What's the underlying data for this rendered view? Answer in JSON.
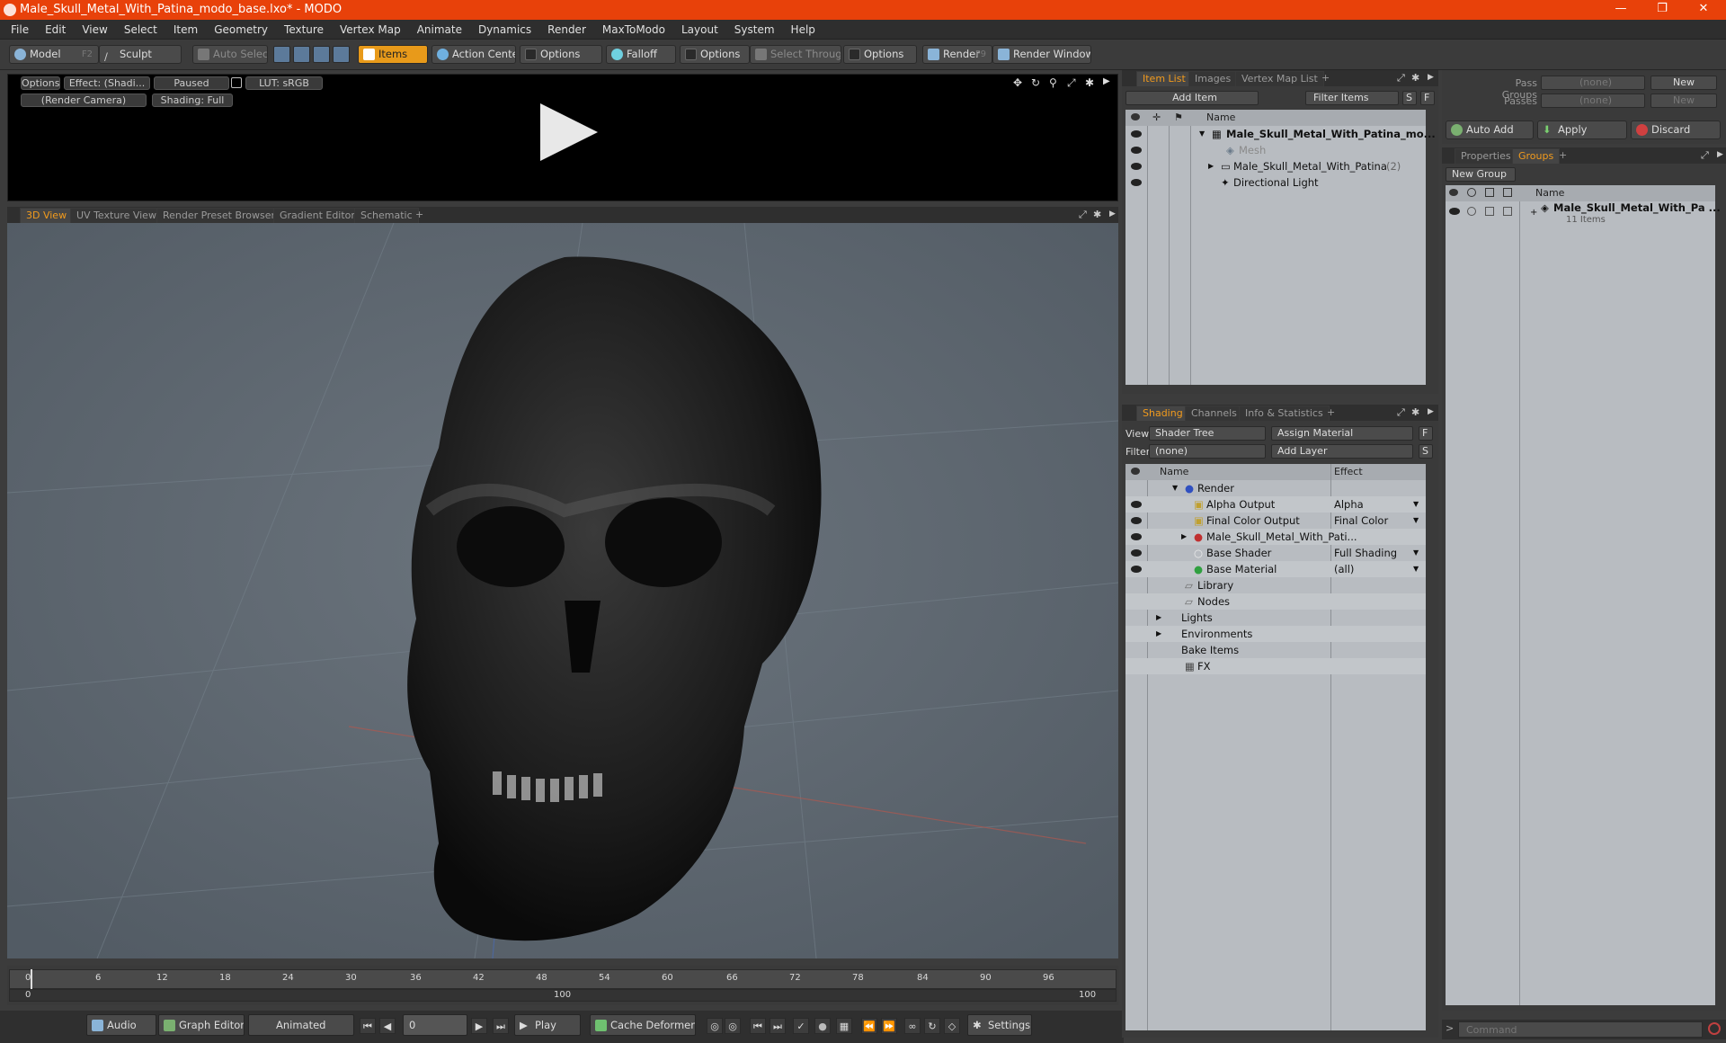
{
  "title": "Male_Skull_Metal_With_Patina_modo_base.lxo* - MODO",
  "window_controls": {
    "minimize": "—",
    "restore": "❐",
    "close": "✕"
  },
  "menu": [
    "File",
    "Edit",
    "View",
    "Select",
    "Item",
    "Geometry",
    "Texture",
    "Vertex Map",
    "Animate",
    "Dynamics",
    "Render",
    "MaxToModo",
    "Layout",
    "System",
    "Help"
  ],
  "toolbar": {
    "model": "Model",
    "model_key": "F2",
    "sculpt": "Sculpt",
    "auto_select": "Auto Select",
    "items": "Items",
    "action_center": "Action Center",
    "options1": "Options",
    "falloff": "Falloff",
    "options2": "Options",
    "select_through": "Select Through",
    "options3": "Options",
    "render": "Render",
    "render_key": "F9",
    "render_window": "Render Window"
  },
  "preview": {
    "options": "Options",
    "effect": "Effect: (Shadi...",
    "paused": "Paused",
    "lut": "LUT: sRGB",
    "camera": "(Render Camera)",
    "shading": "Shading: Full"
  },
  "viewport_tabs": [
    "3D View",
    "UV Texture View",
    "Render Preset Browser",
    "Gradient Editor",
    "Schematic",
    "+"
  ],
  "timeline": {
    "ticks": [
      "0",
      "6",
      "12",
      "18",
      "24",
      "30",
      "36",
      "42",
      "48",
      "54",
      "60",
      "66",
      "72",
      "78",
      "84",
      "90",
      "96"
    ],
    "range_start": "0",
    "range_mid": "100",
    "range_end": "100"
  },
  "bottom": {
    "audio": "Audio",
    "graph_editor": "Graph Editor",
    "animated": "Animated",
    "frame": "0",
    "play": "Play",
    "cache_deformers": "Cache Deformers",
    "settings": "Settings"
  },
  "item_list": {
    "tabs": [
      "Item List",
      "Images",
      "Vertex Map List",
      "+"
    ],
    "add_item": "Add Item",
    "filter_items": "Filter Items",
    "s": "S",
    "f": "F",
    "col_name": "Name",
    "rows": [
      {
        "label": "Male_Skull_Metal_With_Patina_mo..."
      },
      {
        "label": "Mesh"
      },
      {
        "label": "Male_Skull_Metal_With_Patina",
        "count": "(2)"
      },
      {
        "label": "Directional Light"
      }
    ]
  },
  "shading": {
    "tabs": [
      "Shading",
      "Channels",
      "Info & Statistics",
      "+"
    ],
    "view_label": "View",
    "view_value": "Shader Tree",
    "assign_material": "Assign Material",
    "filter_label": "Filter",
    "filter_value": "(none)",
    "add_layer": "Add Layer",
    "f": "F",
    "s": "S",
    "col_name": "Name",
    "col_effect": "Effect",
    "rows": [
      {
        "name": "Render",
        "effect": ""
      },
      {
        "name": "Alpha Output",
        "effect": "Alpha"
      },
      {
        "name": "Final Color Output",
        "effect": "Final Color"
      },
      {
        "name": "Male_Skull_Metal_With_Pati...",
        "effect": ""
      },
      {
        "name": "Base Shader",
        "effect": "Full Shading"
      },
      {
        "name": "Base Material",
        "effect": "(all)"
      },
      {
        "name": "Library",
        "effect": ""
      },
      {
        "name": "Nodes",
        "effect": ""
      },
      {
        "name": "Lights",
        "effect": ""
      },
      {
        "name": "Environments",
        "effect": ""
      },
      {
        "name": "Bake Items",
        "effect": ""
      },
      {
        "name": "FX",
        "effect": ""
      }
    ]
  },
  "passes": {
    "pass_groups_label": "Pass Groups",
    "pass_groups_value": "(none)",
    "new1": "New",
    "passes_label": "Passes",
    "passes_value": "(none)",
    "new2": "New",
    "auto_add": "Auto Add",
    "apply": "Apply",
    "discard": "Discard"
  },
  "groups": {
    "tabs": [
      "Properties",
      "Groups",
      "+"
    ],
    "new_group": "New Group",
    "col_name": "Name",
    "group_name": "Male_Skull_Metal_With_Pa ...",
    "group_count": "11 Items"
  },
  "command": {
    "placeholder": "Command",
    "prompt": ">"
  }
}
